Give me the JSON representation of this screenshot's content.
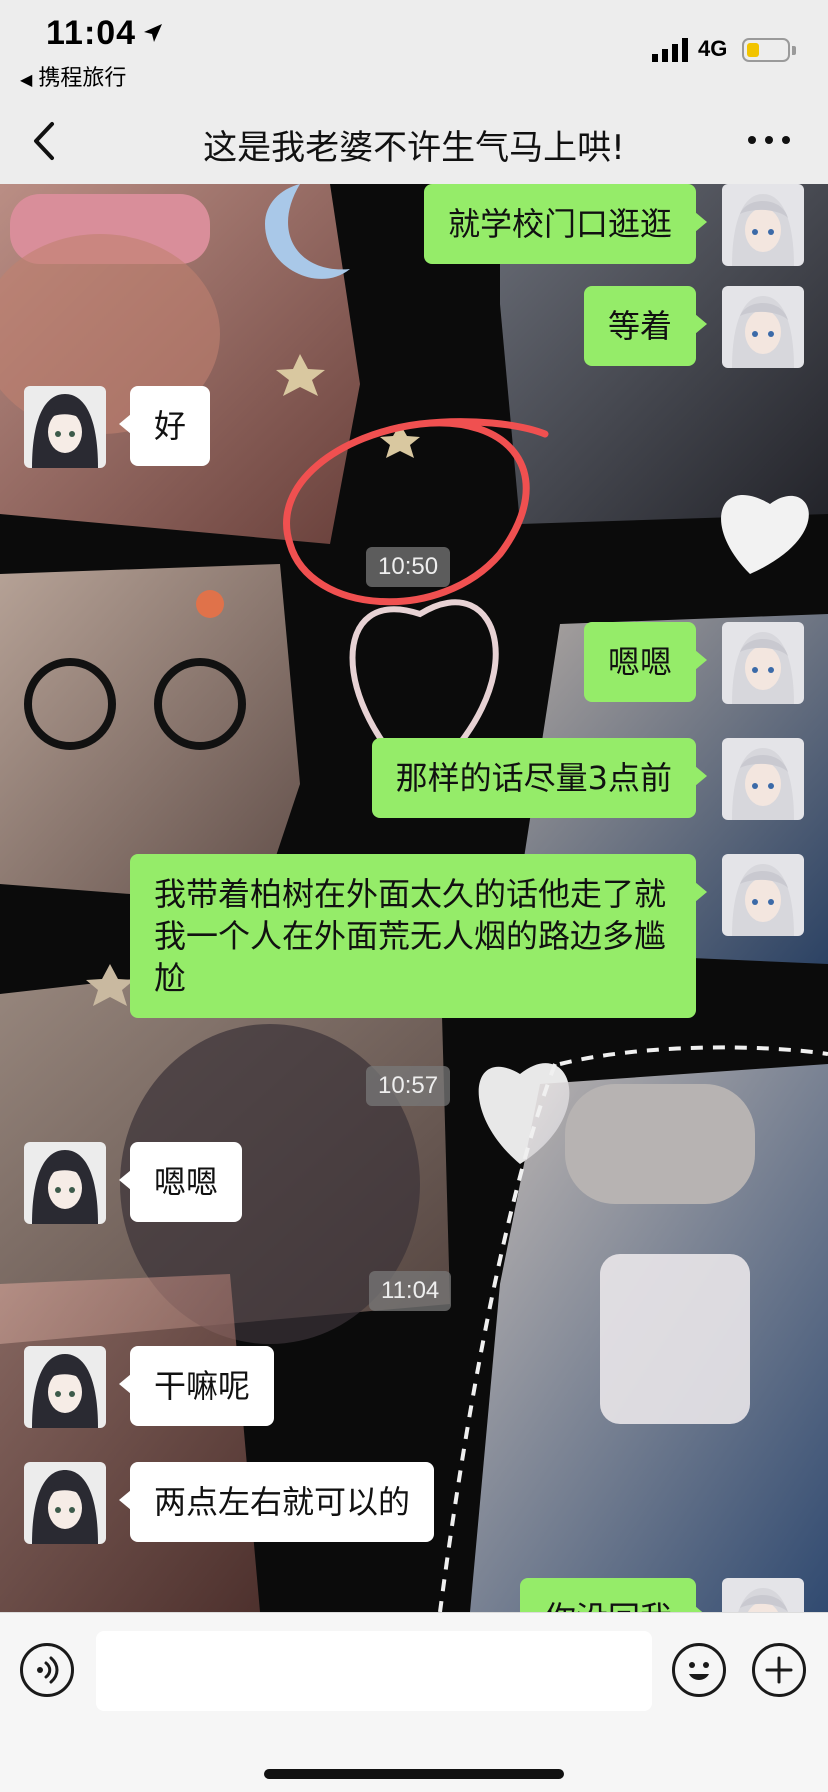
{
  "status_bar": {
    "time": "11:04",
    "back_app": "携程旅行",
    "network": "4G"
  },
  "nav": {
    "title": "这是我老婆不许生气马上哄!"
  },
  "messages": [
    {
      "side": "out",
      "text": "就学校门口逛逛"
    },
    {
      "side": "out",
      "text": "等着"
    },
    {
      "side": "in",
      "text": "好"
    },
    {
      "side": "time",
      "text": "10:50"
    },
    {
      "side": "out",
      "text": "嗯嗯"
    },
    {
      "side": "out",
      "text": "那样的话尽量3点前"
    },
    {
      "side": "out",
      "text": "我带着柏树在外面太久的话他走了就我一个人在外面荒无人烟的路边多尴尬"
    },
    {
      "side": "time",
      "text": "10:57"
    },
    {
      "side": "in",
      "text": "嗯嗯"
    },
    {
      "side": "time",
      "text": "11:04"
    },
    {
      "side": "in",
      "text": "干嘛呢"
    },
    {
      "side": "in",
      "text": "两点左右就可以的"
    },
    {
      "side": "out",
      "text": "你没回我"
    }
  ],
  "input": {
    "value": "",
    "placeholder": ""
  },
  "icons": {
    "voice": "voice-icon",
    "emoji": "emoji-icon",
    "plus": "plus-icon",
    "back": "chevron-left-icon",
    "more": "more-icon"
  },
  "colors": {
    "outgoing_bubble": "#95ec69",
    "incoming_bubble": "#ffffff",
    "annotation_circle": "#f05050"
  }
}
